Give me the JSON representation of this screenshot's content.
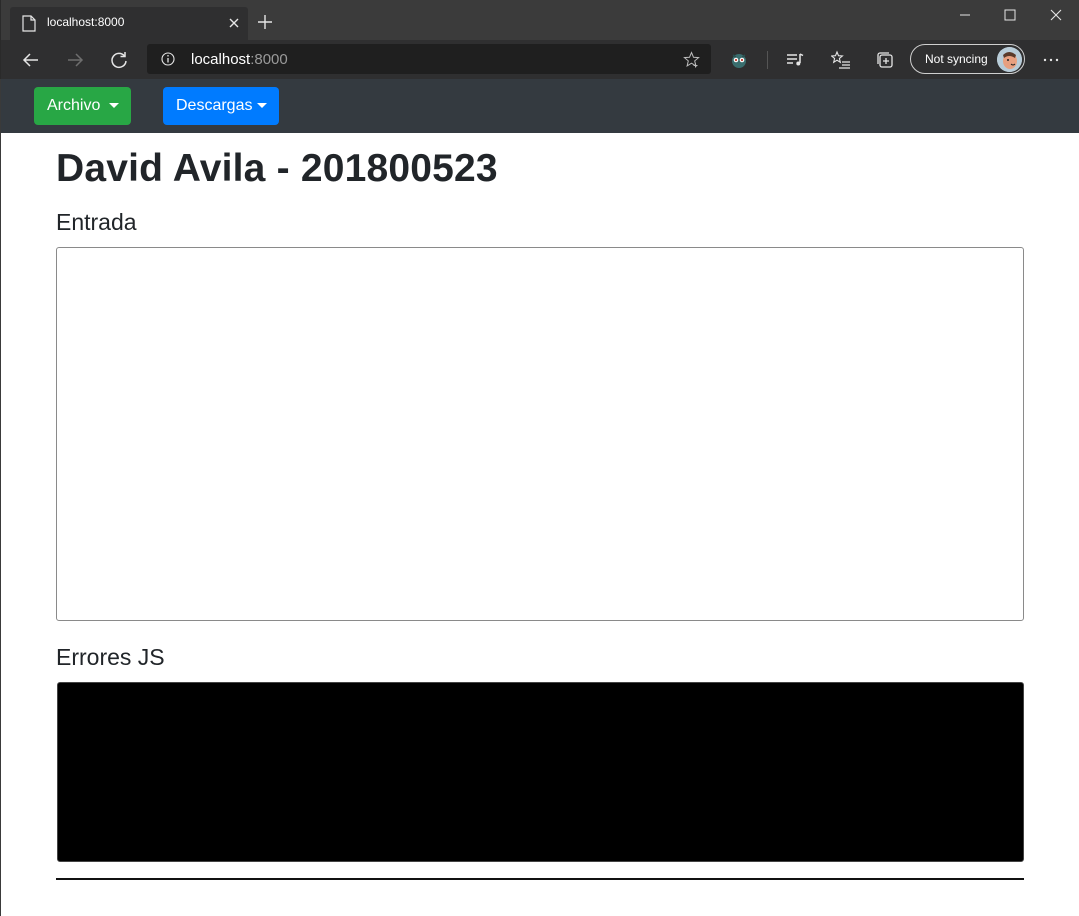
{
  "browser": {
    "tab_title": "localhost:8000",
    "url_host": "localhost",
    "url_port": ":8000",
    "sync_label": "Not syncing"
  },
  "navbar": {
    "archivo_label": "Archivo",
    "descargas_label": "Descargas",
    "archivo_color": "#28a745",
    "descargas_color": "#007bff"
  },
  "main": {
    "title": "David Avila - 201800523",
    "entrada_label": "Entrada",
    "entrada_value": "",
    "errores_label": "Errores JS",
    "errores_value": ""
  }
}
